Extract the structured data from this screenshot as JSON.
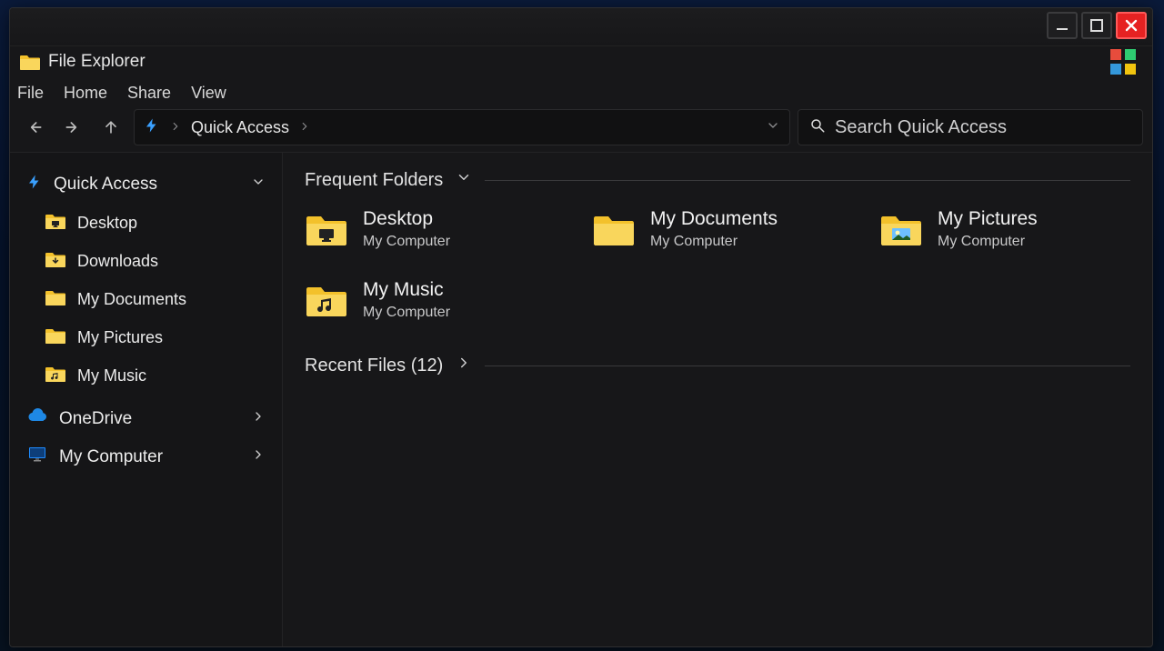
{
  "window": {
    "title": "File Explorer"
  },
  "menu": {
    "file": "File",
    "home": "Home",
    "share": "Share",
    "view": "View"
  },
  "address": {
    "location": "Quick Access"
  },
  "search": {
    "placeholder": "Search Quick Access"
  },
  "sidebar": {
    "quick_access": "Quick Access",
    "items": [
      {
        "label": "Desktop",
        "icon": "desktop"
      },
      {
        "label": "Downloads",
        "icon": "downloads"
      },
      {
        "label": "My Documents",
        "icon": "plain"
      },
      {
        "label": "My Pictures",
        "icon": "plain"
      },
      {
        "label": "My Music",
        "icon": "music"
      }
    ],
    "onedrive": "OneDrive",
    "my_computer": "My Computer"
  },
  "sections": {
    "frequent": "Frequent Folders",
    "recent": "Recent Files (12)"
  },
  "frequent": [
    {
      "title": "Desktop",
      "sub": "My Computer",
      "icon": "desktop"
    },
    {
      "title": "My Documents",
      "sub": "My Computer",
      "icon": "plain"
    },
    {
      "title": "My Pictures",
      "sub": "My Computer",
      "icon": "pictures"
    },
    {
      "title": "My Music",
      "sub": "My Computer",
      "icon": "music"
    }
  ]
}
